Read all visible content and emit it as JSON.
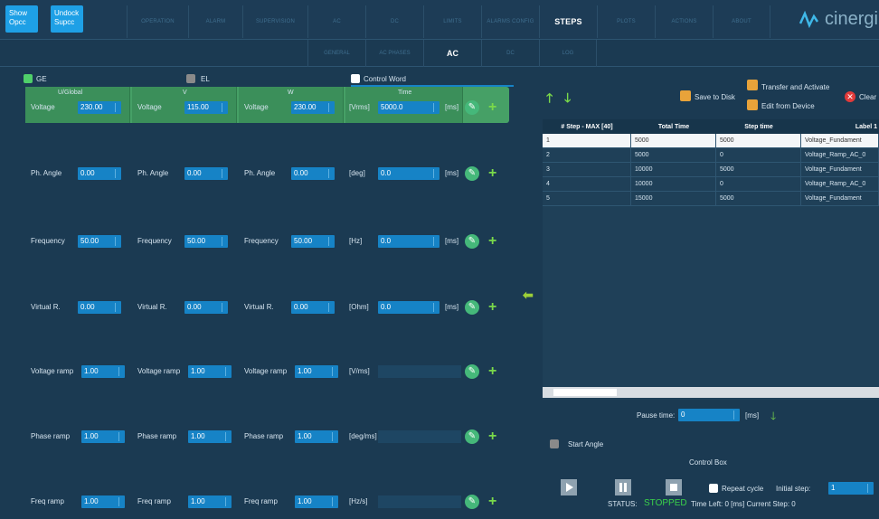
{
  "top": {
    "show_opc": "Show Opcc",
    "undock": "Undock Supcc",
    "tabs": [
      "OPERATION",
      "ALARM",
      "SUPERVISION",
      "AC",
      "DC",
      "LIMITS",
      "ALARMS CONFIG",
      "STEPS",
      "PLOTS",
      "ACTIONS",
      "ABOUT"
    ],
    "active_tab": "STEPS",
    "logo": "cinergi"
  },
  "subtabs": [
    "GENERAL",
    "AC PHASES",
    "AC",
    "DC",
    "LOG"
  ],
  "active_subtab": "AC",
  "modes": {
    "ge": "GE",
    "el": "EL",
    "control_word": "Control Word"
  },
  "headers": {
    "c1": "U/Global",
    "c2": "V",
    "c3": "W",
    "time": "Time"
  },
  "rows": [
    {
      "label": "Voltage",
      "v1": "230.00",
      "v2": "115.00",
      "v3": "230.00",
      "unit": "[Vrms]",
      "t": "5000.0"
    },
    {
      "label": "Ph. Angle",
      "v1": "0.00",
      "v2": "0.00",
      "v3": "0.00",
      "unit": "[deg]",
      "t": "0.0"
    },
    {
      "label": "Frequency",
      "v1": "50.00",
      "v2": "50.00",
      "v3": "50.00",
      "unit": "[Hz]",
      "t": "0.0"
    },
    {
      "label": "Virtual R.",
      "v1": "0.00",
      "v2": "0.00",
      "v3": "0.00",
      "unit": "[Ohm]",
      "t": "0.0"
    },
    {
      "label": "Voltage ramp",
      "v1": "1.00",
      "v2": "1.00",
      "v3": "1.00",
      "unit": "[V/ms]",
      "t": ""
    },
    {
      "label": "Phase ramp",
      "v1": "1.00",
      "v2": "1.00",
      "v3": "1.00",
      "unit": "[deg/ms]",
      "t": ""
    },
    {
      "label": "Freq ramp",
      "v1": "1.00",
      "v2": "1.00",
      "v3": "1.00",
      "unit": "[Hz/s]",
      "t": ""
    }
  ],
  "ms_unit": "[ms]",
  "actions": {
    "save": "Save to Disk",
    "transfer": "Transfer and Activate",
    "edit": "Edit from Device",
    "clear": "Clear"
  },
  "table": {
    "headers": [
      "# Step - MAX [40]",
      "Total Time",
      "Step time",
      "Label 1"
    ],
    "rows": [
      [
        "1",
        "5000",
        "5000",
        "Voltage_Fundament"
      ],
      [
        "2",
        "5000",
        "0",
        "Voltage_Ramp_AC_0"
      ],
      [
        "3",
        "10000",
        "5000",
        "Voltage_Fundament"
      ],
      [
        "4",
        "10000",
        "0",
        "Voltage_Ramp_AC_0"
      ],
      [
        "5",
        "15000",
        "5000",
        "Voltage_Fundament"
      ]
    ]
  },
  "pause": {
    "label": "Pause time:",
    "value": "0",
    "unit": "[ms]"
  },
  "start_angle": "Start Angle",
  "control_box": "Control Box",
  "repeat": "Repeat cycle",
  "initial_step": {
    "label": "Initial step:",
    "value": "1"
  },
  "status": {
    "label": "STATUS:",
    "value": "STOPPED",
    "rest": "Time Left: 0 [ms] Current Step: 0"
  },
  "colors": {
    "accent": "#1683c6",
    "green": "#46a066",
    "stopped": "#3ad14a"
  }
}
